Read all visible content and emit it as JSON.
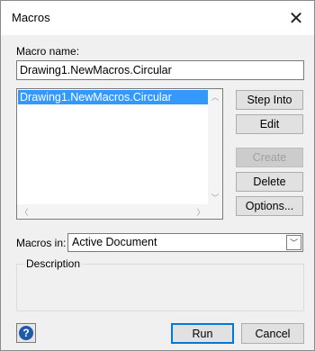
{
  "window": {
    "title": "Macros",
    "close_glyph": "✕"
  },
  "macro_name": {
    "label": "Macro name:",
    "value": "Drawing1.NewMacros.Circular"
  },
  "macro_list": {
    "items": [
      "Drawing1.NewMacros.Circular"
    ],
    "selected_index": 0
  },
  "buttons": {
    "step_into": "Step Into",
    "edit": "Edit",
    "create": "Create",
    "delete": "Delete",
    "options": "Options...",
    "run": "Run",
    "cancel": "Cancel"
  },
  "macros_in": {
    "label": "Macros in:",
    "selected": "Active Document"
  },
  "description": {
    "label": "Description",
    "text": ""
  },
  "help": {
    "glyph": "?"
  },
  "colors": {
    "selection": "#3399ff",
    "default_button_border": "#0078d7",
    "help_icon": "#1e5aa8"
  }
}
